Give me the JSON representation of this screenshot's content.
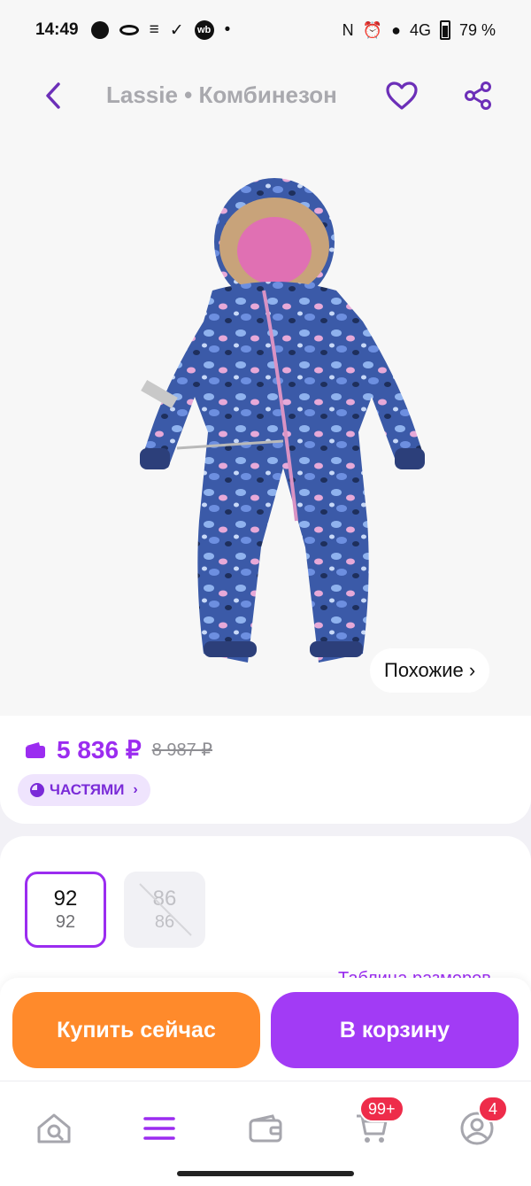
{
  "status_bar": {
    "time": "14:49",
    "battery": "79 %",
    "network": "4G"
  },
  "header": {
    "title": "Lassie • Комбинезон",
    "back_icon": "chevron-left-icon",
    "favorite_icon": "heart-icon",
    "share_icon": "share-icon"
  },
  "product": {
    "image_alt": "Детский зимний комбинезон с капюшоном",
    "similar_label": "Похожие ›"
  },
  "price": {
    "current": "5 836 ₽",
    "old": "8 987 ₽",
    "installments_label": "ЧАСТЯМИ"
  },
  "sizes": {
    "options": [
      {
        "size": "92",
        "sub": "92",
        "state": "selected"
      },
      {
        "size": "86",
        "sub": "86",
        "state": "unavailable"
      }
    ],
    "table_link": "Таблица размеров"
  },
  "actions": {
    "buy_now": "Купить сейчас",
    "add_to_cart": "В корзину"
  },
  "nav": {
    "cart_badge": "99+",
    "profile_badge": "4"
  },
  "colors": {
    "accent": "#9b2cf0",
    "buy_now": "#ff8a2b",
    "add_to_cart": "#a23bf5",
    "badge": "#ee2c4a"
  }
}
